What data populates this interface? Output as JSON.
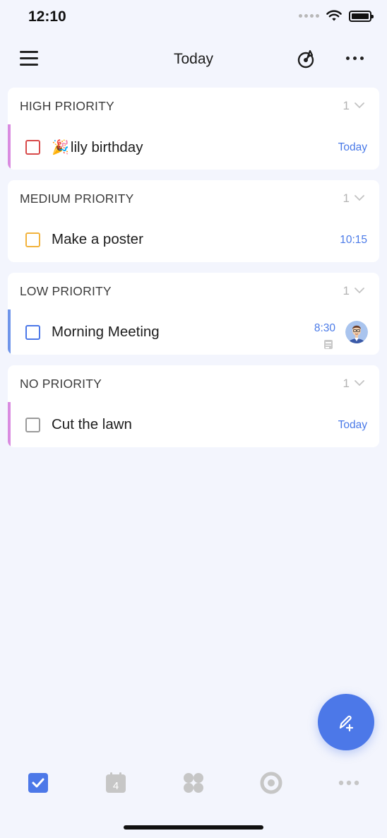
{
  "status": {
    "time": "12:10"
  },
  "header": {
    "title": "Today"
  },
  "sections": [
    {
      "title": "HIGH PRIORITY",
      "count": "1",
      "task": {
        "emoji": "🎉",
        "title": "lily birthday",
        "date": "Today"
      }
    },
    {
      "title": "MEDIUM PRIORITY",
      "count": "1",
      "task": {
        "title": "Make a poster",
        "date": "10:15"
      }
    },
    {
      "title": "LOW PRIORITY",
      "count": "1",
      "task": {
        "title": "Morning Meeting",
        "time": "8:30"
      }
    },
    {
      "title": "NO PRIORITY",
      "count": "1",
      "task": {
        "title": "Cut the lawn",
        "date": "Today"
      }
    }
  ],
  "tabbar": {
    "calendar_day": "4"
  },
  "colors": {
    "accent": "#4c78e8",
    "high": "#d84a4a",
    "medium": "#f2b33d",
    "low": "#4c78e8",
    "none": "#9a9a9a",
    "stripe_pink": "#d98be0",
    "stripe_blue": "#6f95ea"
  },
  "icons": {
    "menu": "menu-icon",
    "theme": "theme-icon",
    "more": "more-icon",
    "fab": "edit-add-icon",
    "tabs": [
      "checkbox-tab-icon",
      "calendar-tab-icon",
      "apps-tab-icon",
      "focus-tab-icon",
      "more-tab-icon"
    ]
  }
}
